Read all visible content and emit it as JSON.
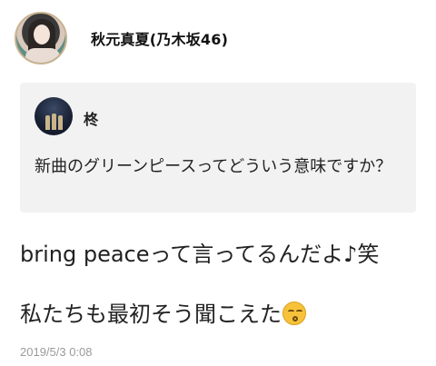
{
  "post": {
    "author": "秋元真夏(乃木坂46)",
    "quote": {
      "sender": "柊",
      "message": "新曲のグリーンピースってどういう意味ですか？"
    },
    "reply_line1": "bring peaceって言ってるんだよ♪笑",
    "reply_line2": "私たちも最初そう聞こえた",
    "reply_emoji": "kissing-face-with-closed-eyes-icon",
    "timestamp": "2019/5/3 0:08"
  }
}
